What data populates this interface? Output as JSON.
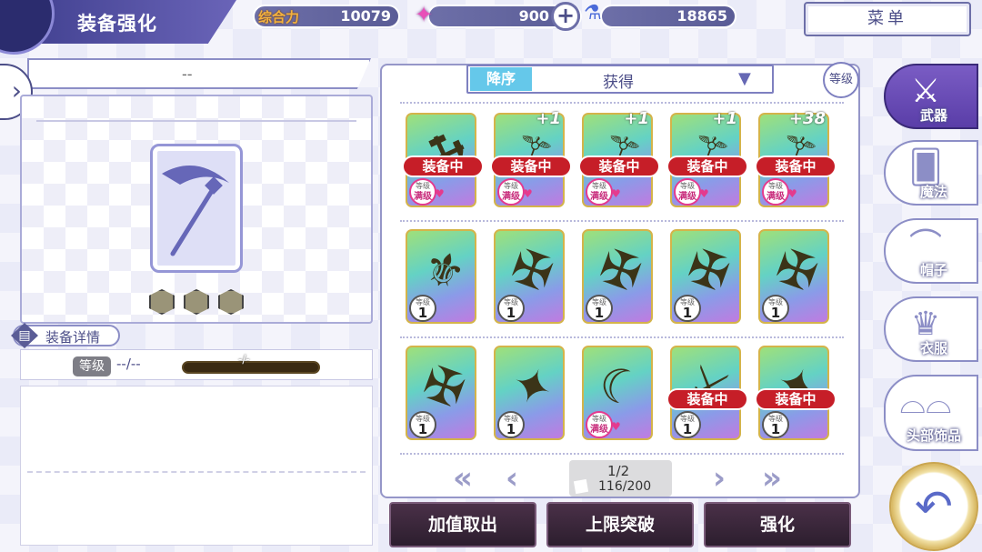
{
  "header": {
    "title": "装备强化",
    "menu_label": "菜单"
  },
  "stats": {
    "power_label": "综合力",
    "power_value": "10079",
    "gem_value": "900",
    "potion_value": "18865"
  },
  "left": {
    "item_name": "--",
    "detail_label": "装备详情",
    "level_label": "等级",
    "level_value": "--/--",
    "level_bar_text": "-/-"
  },
  "sort": {
    "order": "降序",
    "key": "获得",
    "grade_button": "等级"
  },
  "grid": {
    "equipped_label": "装备中",
    "level_caption": "等级",
    "max_label": "满级",
    "cards": [
      {
        "equipped": true,
        "level": "满级",
        "plus": ""
      },
      {
        "equipped": true,
        "level": "满级",
        "plus": "+1"
      },
      {
        "equipped": true,
        "level": "满级",
        "plus": "+1"
      },
      {
        "equipped": true,
        "level": "满级",
        "plus": "+1"
      },
      {
        "equipped": true,
        "level": "满级",
        "plus": "+38"
      },
      {
        "equipped": false,
        "level": "1",
        "plus": ""
      },
      {
        "equipped": false,
        "level": "1",
        "plus": ""
      },
      {
        "equipped": false,
        "level": "1",
        "plus": ""
      },
      {
        "equipped": false,
        "level": "1",
        "plus": ""
      },
      {
        "equipped": false,
        "level": "1",
        "plus": ""
      },
      {
        "equipped": false,
        "level": "1",
        "plus": ""
      },
      {
        "equipped": false,
        "level": "1",
        "plus": ""
      },
      {
        "equipped": false,
        "level": "满级",
        "plus": ""
      },
      {
        "equipped": true,
        "level": "1",
        "plus": ""
      },
      {
        "equipped": true,
        "level": "1",
        "plus": ""
      }
    ]
  },
  "pagination": {
    "page": "1/2",
    "count": "116/200"
  },
  "actions": {
    "withdraw": "加值取出",
    "limit_break": "上限突破",
    "enhance": "强化"
  },
  "tabs": [
    {
      "label": "武器",
      "icon": "crossed-weapons-icon",
      "active": true
    },
    {
      "label": "魔法",
      "icon": "magic-cards-icon",
      "active": false
    },
    {
      "label": "帽子",
      "icon": "hat-icon",
      "active": false
    },
    {
      "label": "衣服",
      "icon": "clothes-icon",
      "active": false
    },
    {
      "label": "头部饰品",
      "icon": "glasses-icon",
      "active": false
    }
  ],
  "colors": {
    "accent": "#4c4e88",
    "equipped_red": "#c61e28",
    "sort_blue": "#65c8ea"
  }
}
